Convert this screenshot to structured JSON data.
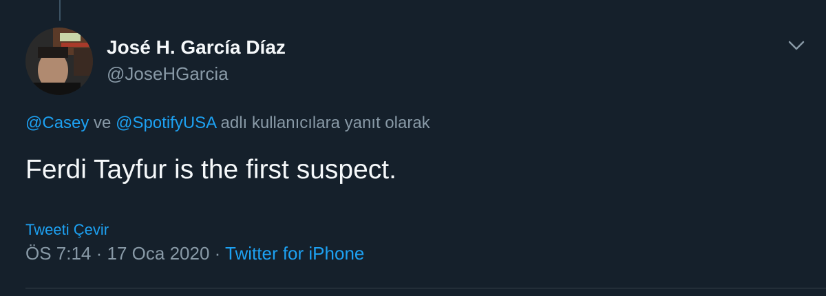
{
  "tweet": {
    "author": {
      "display_name": "José H. García Díaz",
      "handle": "@JoseHGarcia"
    },
    "menu_icon": "chevron-down-icon",
    "reply_context": {
      "mention_1": "@Casey",
      "connector": " ve ",
      "mention_2": "@SpotifyUSA",
      "suffix": " adlı kullanıcılara yanıt olarak"
    },
    "text": "Ferdi Tayfur is the first suspect.",
    "translate_label": "Tweeti Çevir",
    "time": "ÖS 7:14",
    "separator": " · ",
    "date": "17 Oca 2020",
    "source": "Twitter for iPhone"
  },
  "colors": {
    "background": "#15202b",
    "accent": "#1da1f2",
    "secondary_text": "#8899a6",
    "primary_text": "#f5f8fa",
    "divider": "#38444d"
  }
}
